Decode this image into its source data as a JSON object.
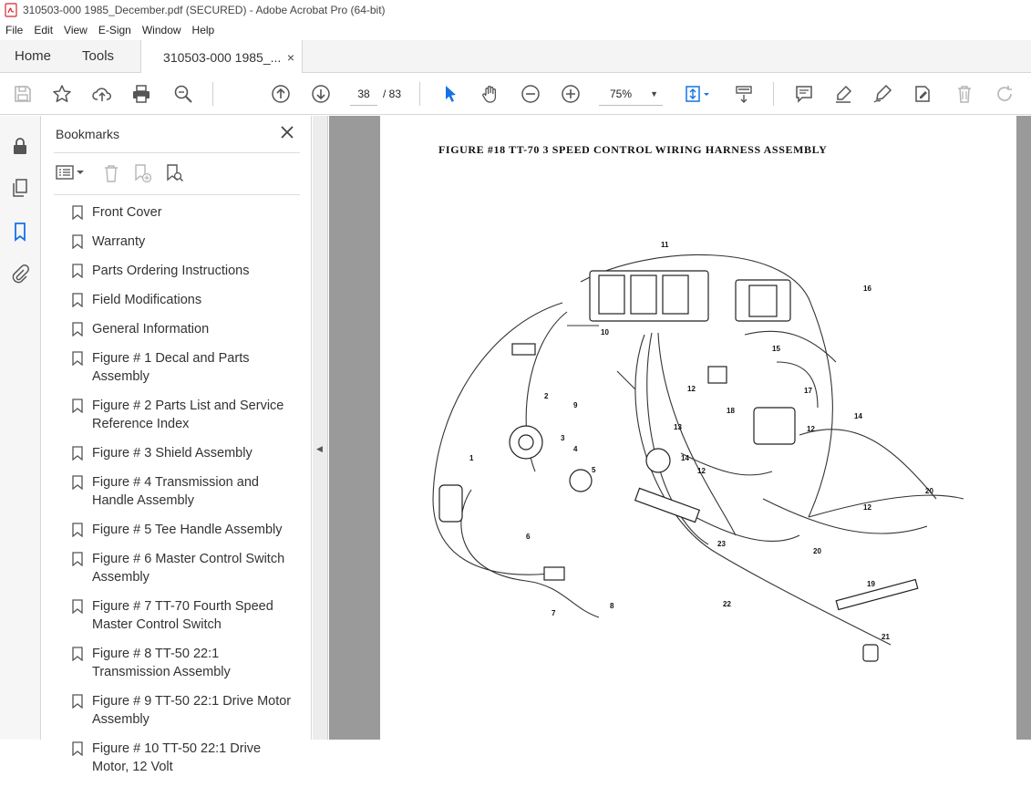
{
  "window": {
    "title": "310503-000 1985_December.pdf (SECURED) - Adobe Acrobat Pro (64-bit)"
  },
  "menu": [
    "File",
    "Edit",
    "View",
    "E-Sign",
    "Window",
    "Help"
  ],
  "tabs": {
    "home": "Home",
    "tools": "Tools",
    "document": "310503-000 1985_...",
    "close": "×"
  },
  "toolbar": {
    "page_current": "38",
    "page_total": "/ 83",
    "zoom": "75%"
  },
  "bookmarks": {
    "title": "Bookmarks",
    "items": [
      "Front Cover",
      "Warranty",
      "Parts Ordering Instructions",
      "Field Modifications",
      "General Information",
      "Figure # 1 Decal and Parts Assembly",
      "Figure # 2 Parts List and Service Reference Index",
      "Figure # 3 Shield Assembly",
      "Figure # 4 Transmission and Handle Assembly",
      "Figure # 5 Tee Handle Assembly",
      "Figure # 6 Master Control Switch Assembly",
      "Figure # 7 TT-70 Fourth Speed Master Control Switch",
      "Figure # 8 TT-50 22:1 Transmission Assembly",
      "Figure # 9 TT-50 22:1 Drive Motor Assembly",
      "Figure # 10 TT-50 22:1 Drive Motor, 12 Volt"
    ]
  },
  "document": {
    "figure_title": "FIGURE #18  TT-70  3 SPEED CONTROL WIRING HARNESS ASSEMBLY",
    "callouts": [
      "1",
      "2",
      "3",
      "4",
      "5",
      "6",
      "7",
      "8",
      "9",
      "10",
      "11",
      "12",
      "12",
      "12",
      "12",
      "13",
      "14",
      "14",
      "15",
      "16",
      "17",
      "18",
      "19",
      "20",
      "20",
      "21",
      "22",
      "23"
    ]
  },
  "colors": {
    "acrobat_red": "#d7282f",
    "link_blue": "#1473e6"
  }
}
